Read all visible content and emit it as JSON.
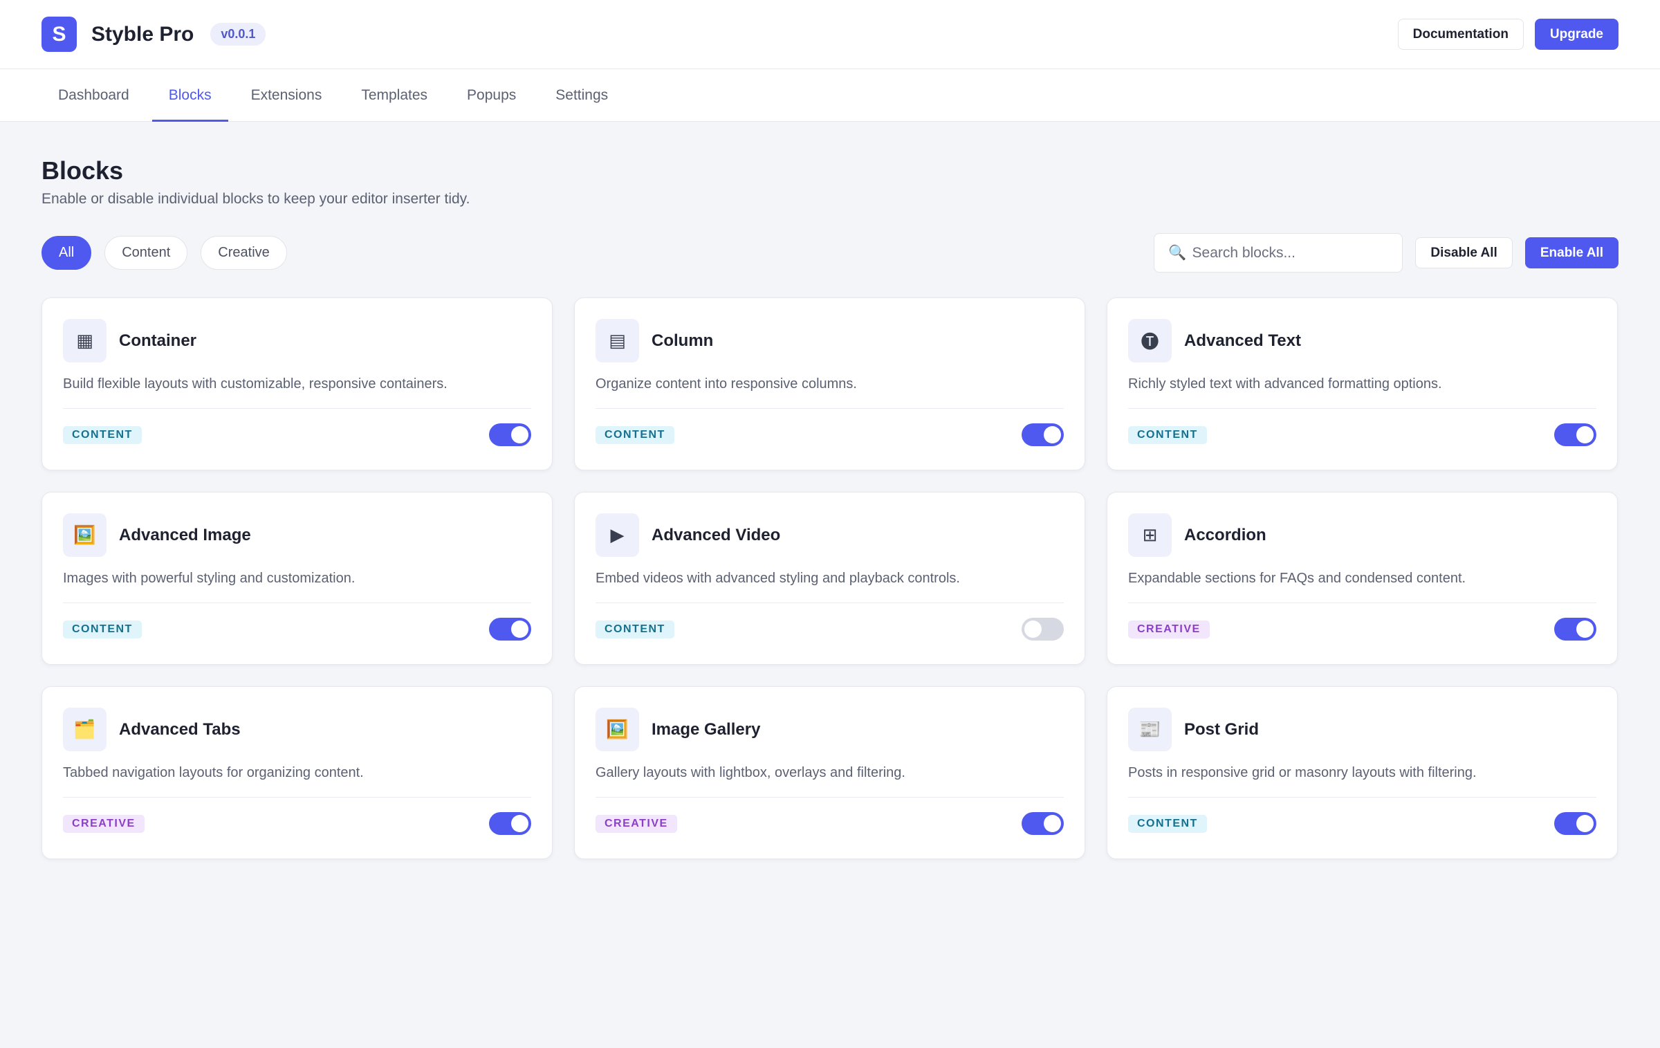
{
  "header": {
    "logo_letter": "S",
    "app_name": "Styble Pro",
    "version": "v0.0.1",
    "documentation_label": "Documentation",
    "upgrade_label": "Upgrade"
  },
  "tabs": [
    {
      "label": "Dashboard",
      "active": false
    },
    {
      "label": "Blocks",
      "active": true
    },
    {
      "label": "Extensions",
      "active": false
    },
    {
      "label": "Templates",
      "active": false
    },
    {
      "label": "Popups",
      "active": false
    },
    {
      "label": "Settings",
      "active": false
    }
  ],
  "page": {
    "title": "Blocks",
    "subtitle": "Enable or disable individual blocks to keep your editor inserter tidy."
  },
  "filters": [
    {
      "label": "All",
      "active": true
    },
    {
      "label": "Content",
      "active": false
    },
    {
      "label": "Creative",
      "active": false
    }
  ],
  "search": {
    "placeholder": "Search blocks...",
    "value": "",
    "icon": "magnifier-icon"
  },
  "actions": {
    "disable_all_label": "Disable All",
    "enable_all_label": "Enable All"
  },
  "colors": {
    "accent": "#4f59f0",
    "content_badge": "#15708e",
    "creative_badge": "#8c3fc6"
  },
  "blocks": [
    {
      "icon": "▦",
      "icon_name": "container-icon",
      "title": "Container",
      "description": "Build flexible layouts with customizable, responsive containers.",
      "category": "CONTENT",
      "enabled": true
    },
    {
      "icon": "▤",
      "icon_name": "column-icon",
      "title": "Column",
      "description": "Organize content into responsive columns.",
      "category": "CONTENT",
      "enabled": true
    },
    {
      "icon": "🅣",
      "icon_name": "text-icon",
      "title": "Advanced Text",
      "description": "Richly styled text with advanced formatting options.",
      "category": "CONTENT",
      "enabled": true
    },
    {
      "icon": "🖼️",
      "icon_name": "image-icon",
      "title": "Advanced Image",
      "description": "Images with powerful styling and customization.",
      "category": "CONTENT",
      "enabled": true
    },
    {
      "icon": "▶",
      "icon_name": "video-icon",
      "title": "Advanced Video",
      "description": "Embed videos with advanced styling and playback controls.",
      "category": "CONTENT",
      "enabled": false
    },
    {
      "icon": "⊞",
      "icon_name": "accordion-icon",
      "title": "Accordion",
      "description": "Expandable sections for FAQs and condensed content.",
      "category": "CREATIVE",
      "enabled": true
    },
    {
      "icon": "🗂️",
      "icon_name": "tabs-icon",
      "title": "Advanced Tabs",
      "description": "Tabbed navigation layouts for organizing content.",
      "category": "CREATIVE",
      "enabled": true
    },
    {
      "icon": "🖼️",
      "icon_name": "gallery-icon",
      "title": "Image Gallery",
      "description": "Gallery layouts with lightbox, overlays and filtering.",
      "category": "CREATIVE",
      "enabled": true
    },
    {
      "icon": "📰",
      "icon_name": "post-grid-icon",
      "title": "Post Grid",
      "description": "Posts in responsive grid or masonry layouts with filtering.",
      "category": "CONTENT",
      "enabled": true
    }
  ]
}
